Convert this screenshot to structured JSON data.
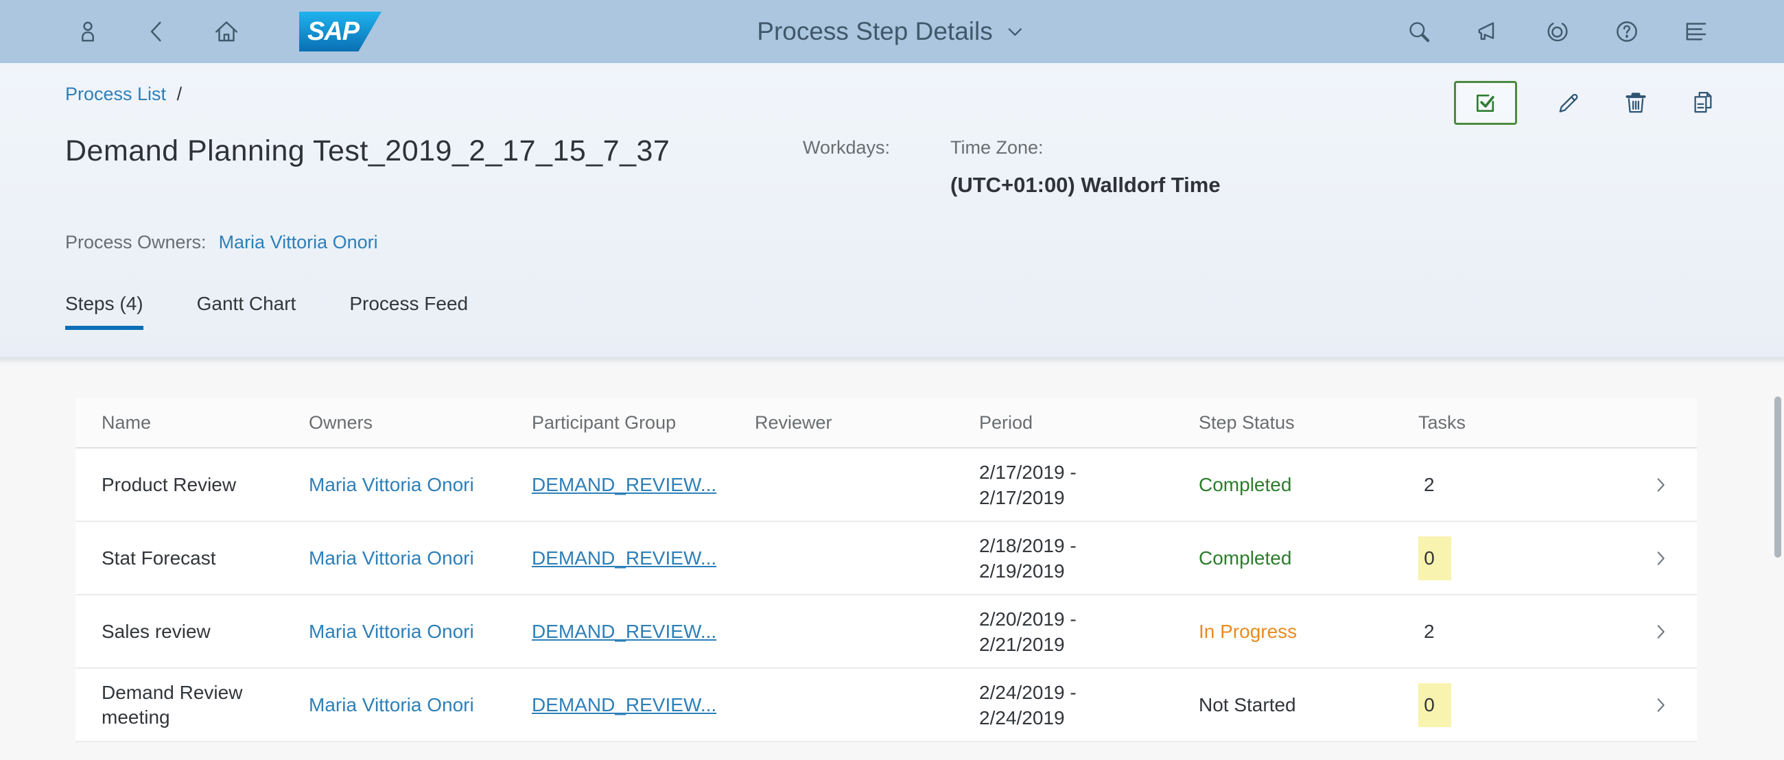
{
  "shell": {
    "title": "Process Step Details",
    "logo_text": "SAP",
    "left_icons": [
      "user",
      "back",
      "home"
    ],
    "right_icons": [
      "search",
      "megaphone",
      "copilot",
      "help",
      "notification-list"
    ]
  },
  "breadcrumb": {
    "link": "Process List",
    "separator": "/"
  },
  "page": {
    "title": "Demand Planning Test_2019_2_17_15_7_37",
    "workdays_label": "Workdays:",
    "timezone_label": "Time Zone:",
    "timezone_value": "(UTC+01:00) Walldorf Time",
    "owners_label": "Process Owners:",
    "owners_value": "Maria Vittoria Onori"
  },
  "header_actions": [
    "approve",
    "edit",
    "delete",
    "copy"
  ],
  "tabs": [
    {
      "label": "Steps (4)",
      "selected": true
    },
    {
      "label": "Gantt Chart",
      "selected": false
    },
    {
      "label": "Process Feed",
      "selected": false
    }
  ],
  "table": {
    "columns": {
      "name": "Name",
      "owners": "Owners",
      "participant_group": "Participant Group",
      "reviewer": "Reviewer",
      "period": "Period",
      "step_status": "Step Status",
      "tasks": "Tasks"
    },
    "rows": [
      {
        "name": "Product Review",
        "owner": "Maria Vittoria Onori",
        "participant_group": "DEMAND_REVIEW...",
        "reviewer": "",
        "period_line1": "2/17/2019 -",
        "period_line2": "2/17/2019",
        "status": "Completed",
        "status_color": "#2b7d2b",
        "tasks": "2",
        "tasks_highlighted": false
      },
      {
        "name": "Stat Forecast",
        "owner": "Maria Vittoria Onori",
        "participant_group": "DEMAND_REVIEW...",
        "reviewer": "",
        "period_line1": "2/18/2019 -",
        "period_line2": "2/19/2019",
        "status": "Completed",
        "status_color": "#2b7d2b",
        "tasks": "0",
        "tasks_highlighted": true
      },
      {
        "name": "Sales review",
        "owner": "Maria Vittoria Onori",
        "participant_group": "DEMAND_REVIEW...",
        "reviewer": "",
        "period_line1": "2/20/2019 -",
        "period_line2": "2/21/2019",
        "status": "In Progress",
        "status_color": "#e78c1f",
        "tasks": "2",
        "tasks_highlighted": false
      },
      {
        "name": "Demand Review meeting",
        "owner": "Maria Vittoria Onori",
        "participant_group": "DEMAND_REVIEW...",
        "reviewer": "",
        "period_line1": "2/24/2019 -",
        "period_line2": "2/24/2019",
        "status": "Not Started",
        "status_color": "#32363a",
        "tasks": "0",
        "tasks_highlighted": true
      }
    ]
  },
  "colors": {
    "shell_bg": "#abc6de",
    "accent_blue": "#0d6fb8",
    "link": "#2d7fb8",
    "status_completed": "#2b7d2b",
    "status_in_progress": "#e78c1f",
    "status_not_started": "#32363a",
    "tasks_highlight": "#f8f3ae"
  }
}
